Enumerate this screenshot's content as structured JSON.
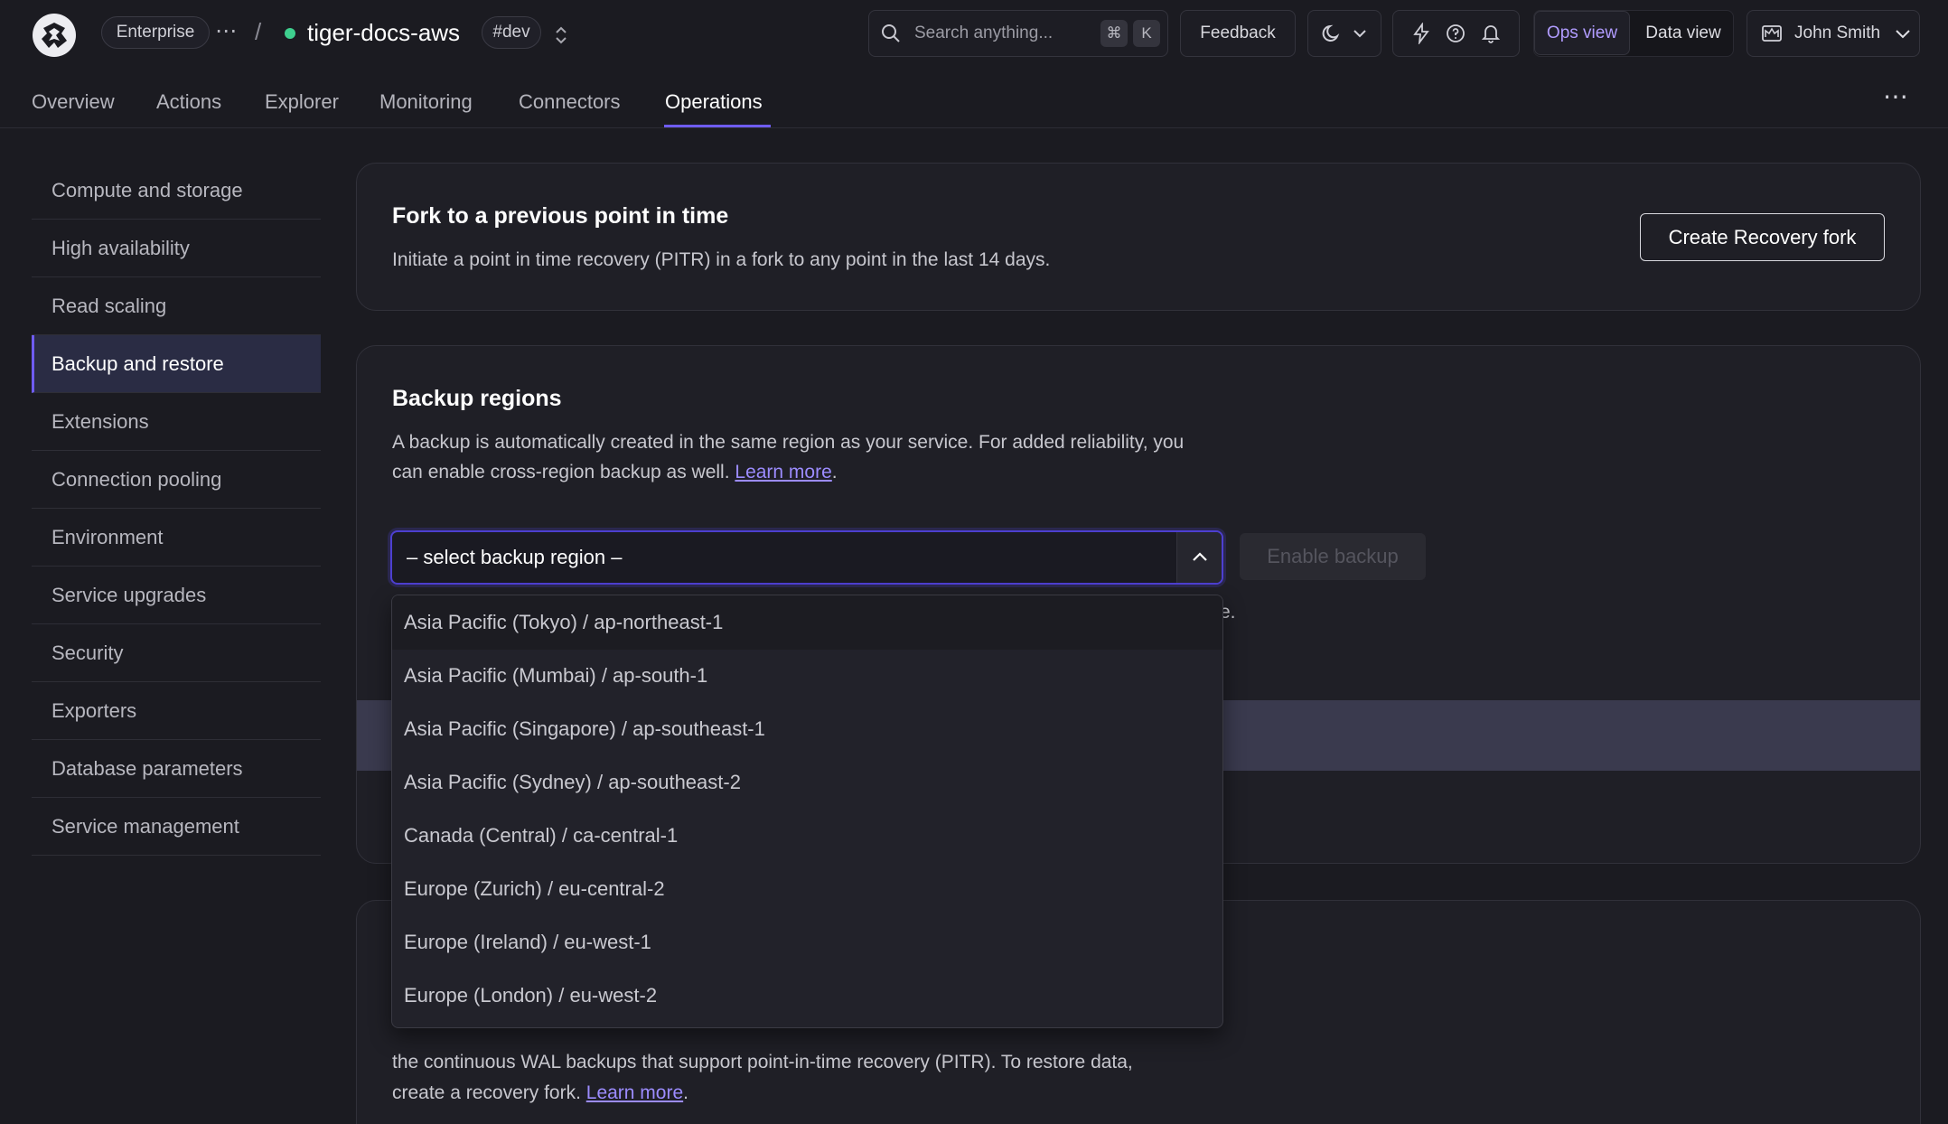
{
  "topbar": {
    "org": "Enterprise",
    "more": "⋯",
    "separator": "/",
    "service_name": "tiger-docs-aws",
    "env_badge": "#dev",
    "search_placeholder": "Search anything...",
    "kbd_cmd": "⌘",
    "kbd_k": "K",
    "feedback": "Feedback",
    "ops_view": "Ops view",
    "data_view": "Data view",
    "user": "John Smith",
    "status_color": "#3ecf8e"
  },
  "tabs": [
    "Overview",
    "Actions",
    "Explorer",
    "Monitoring",
    "Connectors",
    "Operations"
  ],
  "tabs_more": "⋯",
  "sidebar": {
    "items": [
      "Compute and storage",
      "High availability",
      "Read scaling",
      "Backup and restore",
      "Extensions",
      "Connection pooling",
      "Environment",
      "Service upgrades",
      "Security",
      "Exporters",
      "Database parameters",
      "Service management"
    ],
    "active": "Backup and restore"
  },
  "fork_card": {
    "title": "Fork to a previous point in time",
    "text": "Initiate a point in time recovery (PITR) in a fork to any point in the last 14 days.",
    "button": "Create Recovery fork"
  },
  "backup_card": {
    "title": "Backup regions",
    "text_1": "A backup is automatically created in the same region as your service. For added reliability, you",
    "text_2": "can enable cross-region backup as well.",
    "link": "Learn more",
    "period": ".",
    "select_placeholder": "– select backup region –",
    "enable_button": "Enable backup",
    "partial_text": "e."
  },
  "dropdown": {
    "options": [
      "Asia Pacific (Tokyo) / ap-northeast-1",
      "Asia Pacific (Mumbai) / ap-south-1",
      "Asia Pacific (Singapore) / ap-southeast-1",
      "Asia Pacific (Sydney) / ap-southeast-2",
      "Canada (Central) / ca-central-1",
      "Europe (Zurich) / eu-central-2",
      "Europe (Ireland) / eu-west-1",
      "Europe (London) / eu-west-2"
    ]
  },
  "third_card": {
    "text_1": "the continuous WAL backups that support point-in-time recovery (PITR). To restore data,",
    "text_2": "create a recovery fork.",
    "link": "Learn more",
    "period": "."
  }
}
